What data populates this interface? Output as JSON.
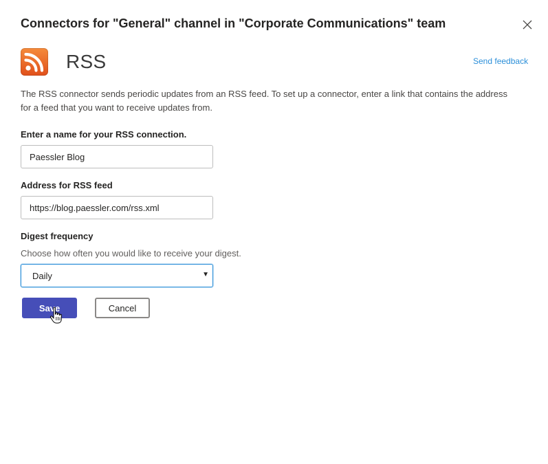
{
  "dialog": {
    "title": "Connectors for \"General\" channel in \"Corporate Communications\" team",
    "close_icon": "close-icon"
  },
  "connector": {
    "icon": "rss-icon",
    "name": "RSS",
    "send_feedback": "Send feedback",
    "description": "The RSS connector sends periodic updates from an RSS feed. To set up a connector, enter a link that contains the address for a feed that you want to receive updates from."
  },
  "form": {
    "name_label": "Enter a name for your RSS connection.",
    "name_value": "Paessler Blog",
    "address_label": "Address for RSS feed",
    "address_value": "https://blog.paessler.com/rss.xml",
    "frequency_label": "Digest frequency",
    "frequency_help": "Choose how often you would like to receive your digest.",
    "frequency_value": "Daily"
  },
  "actions": {
    "save_label": "Save",
    "cancel_label": "Cancel"
  },
  "colors": {
    "accent": "#464eb8",
    "link": "#2b8fd9",
    "rss_orange": "#e8632a"
  }
}
